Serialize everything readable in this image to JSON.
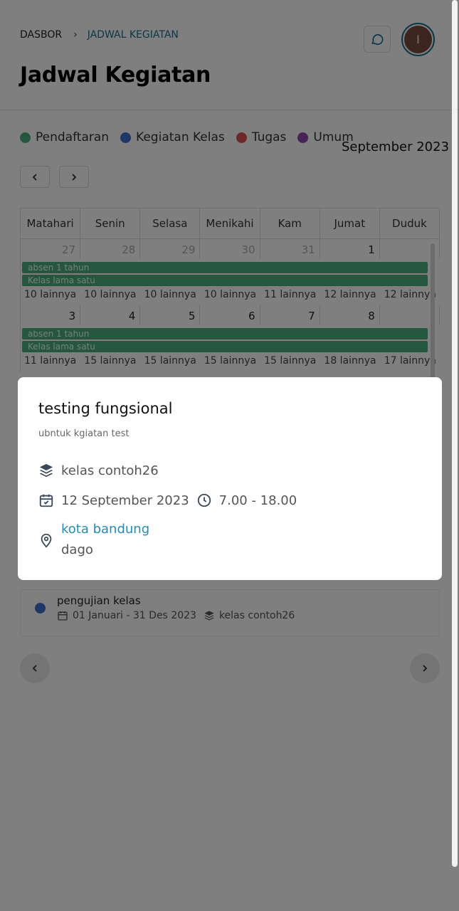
{
  "breadcrumb": {
    "home": "DASBOR",
    "separator": "›",
    "current": "JADWAL KEGIATAN"
  },
  "page_title": "Jadwal Kegiatan",
  "avatar_initial": "I",
  "legend": [
    {
      "label": "Pendaftaran",
      "color": "#4caf7d"
    },
    {
      "label": "Kegiatan Kelas",
      "color": "#3f6ec9"
    },
    {
      "label": "Tugas",
      "color": "#d9534f"
    },
    {
      "label": "Umum",
      "color": "#8e44ad"
    }
  ],
  "month_label": "September 2023",
  "calendar": {
    "weekdays": [
      "Matahari",
      "Senin",
      "Selasa",
      "Menikahi",
      "Kam",
      "Jumat",
      "Duduk"
    ],
    "weeks": [
      {
        "days": [
          "27",
          "28",
          "29",
          "30",
          "31",
          "1",
          ""
        ],
        "events": [
          "absen 1 tahun",
          "Kelas lama satu"
        ],
        "more": [
          "10 lainnya",
          "10 lainnya",
          "10 lainnya",
          "10 lainnya",
          "11 lainnya",
          "12 lainnya",
          "12 lainnya"
        ]
      },
      {
        "days": [
          "3",
          "4",
          "5",
          "6",
          "7",
          "8",
          ""
        ],
        "events": [
          "absen 1 tahun",
          "Kelas lama satu"
        ],
        "more": [
          "11 lainnya",
          "15 lainnya",
          "15 lainnya",
          "15 lainnya",
          "15 lainnya",
          "18 lainnya",
          "17 lainnya"
        ]
      }
    ]
  },
  "list_item": {
    "title": "pengujian kelas",
    "date_range": "01 Januari - 31 Des 2023",
    "class_name": "kelas contoh26"
  },
  "modal": {
    "title": "testing fungsional",
    "description": "ubntuk kgiatan test",
    "class_name": "kelas contoh26",
    "date": "12 September 2023",
    "time": "7.00 - 18.00",
    "location_name": "kota bandung",
    "location_detail": "dago"
  }
}
